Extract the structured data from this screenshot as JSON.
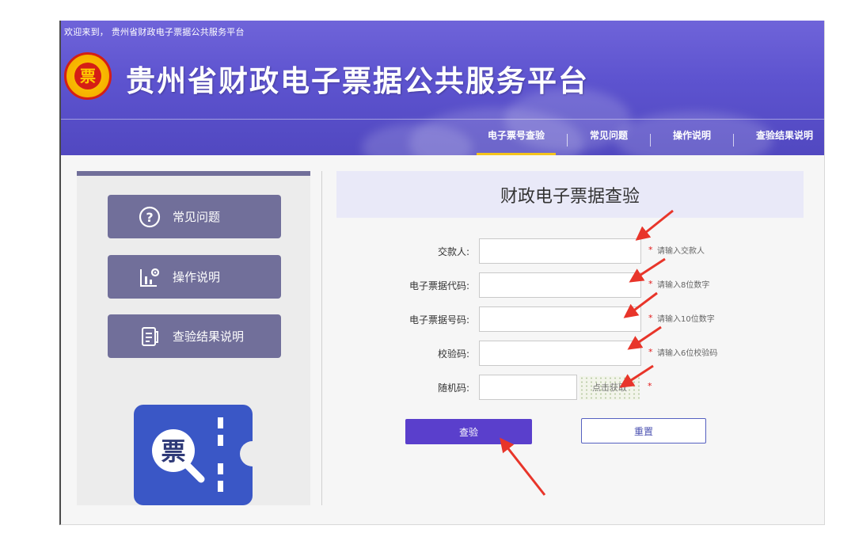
{
  "header": {
    "welcome": "欢迎来到， 贵州省财政电子票据公共服务平台",
    "emblem_text": "票",
    "title": "贵州省财政电子票据公共服务平台",
    "nav": [
      {
        "label": "电子票号查验",
        "active": true
      },
      {
        "label": "常见问题",
        "active": false
      },
      {
        "label": "操作说明",
        "active": false
      },
      {
        "label": "查验结果说明",
        "active": false
      }
    ]
  },
  "sidebar": {
    "items": [
      {
        "label": "常见问题",
        "icon": "question-circle-icon"
      },
      {
        "label": "操作说明",
        "icon": "chart-gear-icon"
      },
      {
        "label": "查验结果说明",
        "icon": "document-icon"
      }
    ],
    "logo_char": "票"
  },
  "form": {
    "title": "财政电子票据查验",
    "fields": [
      {
        "label": "交款人:",
        "value": "",
        "hint": "请输入交款人"
      },
      {
        "label": "电子票据代码:",
        "value": "",
        "hint": "请输入8位数字"
      },
      {
        "label": "电子票据号码:",
        "value": "",
        "hint": "请输入10位数字"
      },
      {
        "label": "校验码:",
        "value": "",
        "hint": "请输入6位校验码"
      }
    ],
    "captcha": {
      "label": "随机码:",
      "value": "",
      "image_text": "点击获取"
    },
    "required_mark": "*",
    "query_button": "查验",
    "reset_button": "重置"
  },
  "colors": {
    "header": "#5d53cf",
    "sidebar_button": "#716f9a",
    "query_button": "#5a3fcc",
    "required": "#e21b1b",
    "arrow": "#e8352a",
    "nav_active": "#f4c41c"
  }
}
